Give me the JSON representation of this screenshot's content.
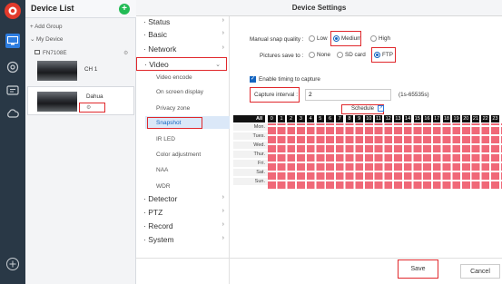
{
  "sidebar_title": "Device List",
  "add_group": "Add Group",
  "my_device": "My Device",
  "device1_name": "FN7108E",
  "device1_channel": "CH 1",
  "device2_name": "Dahua",
  "window_title": "Device Settings",
  "menu": {
    "status": "Status",
    "basic": "Basic",
    "network": "Network",
    "video": "Video",
    "video_encode": "Video encode",
    "on_screen_display": "On screen display",
    "privacy_zone": "Privacy zone",
    "snapshot": "Snapshot",
    "ir_led": "IR LED",
    "color_adjustment": "Color adjustment",
    "naa": "NAA",
    "wdr": "WDR",
    "detector": "Detector",
    "ptz": "PTZ",
    "record": "Record",
    "system": "System"
  },
  "form": {
    "quality_label": "Manual snap quality :",
    "quality_options": [
      "Low",
      "Medium",
      "High"
    ],
    "quality_selected": "Medium",
    "save_to_label": "Pictures save to :",
    "save_to_options": [
      "None",
      "SD card",
      "FTP"
    ],
    "save_to_selected": "FTP",
    "enable_timing": "Enable timing to capture",
    "enable_timing_checked": true,
    "capture_interval_label": "Capture interval :",
    "capture_interval_value": "2",
    "capture_interval_range": "(1s-65535s)"
  },
  "schedule": {
    "button_label": "Schedule",
    "all_label": "All",
    "hours": [
      "0",
      "1",
      "2",
      "3",
      "4",
      "5",
      "6",
      "7",
      "8",
      "9",
      "10",
      "11",
      "12",
      "13",
      "14",
      "15",
      "16",
      "17",
      "18",
      "19",
      "20",
      "21",
      "22",
      "23"
    ],
    "days": [
      "Mon.",
      "Tues.",
      "Wed.",
      "Thur.",
      "Fri.",
      "Sat.",
      "Sun."
    ]
  },
  "buttons": {
    "save": "Save",
    "cancel": "Cancel"
  },
  "colors": {
    "accent": "#1565c0",
    "grid_fill": "#f06878",
    "highlight": "#e0282c",
    "rail": "#293846",
    "add_button": "#22bb55"
  }
}
